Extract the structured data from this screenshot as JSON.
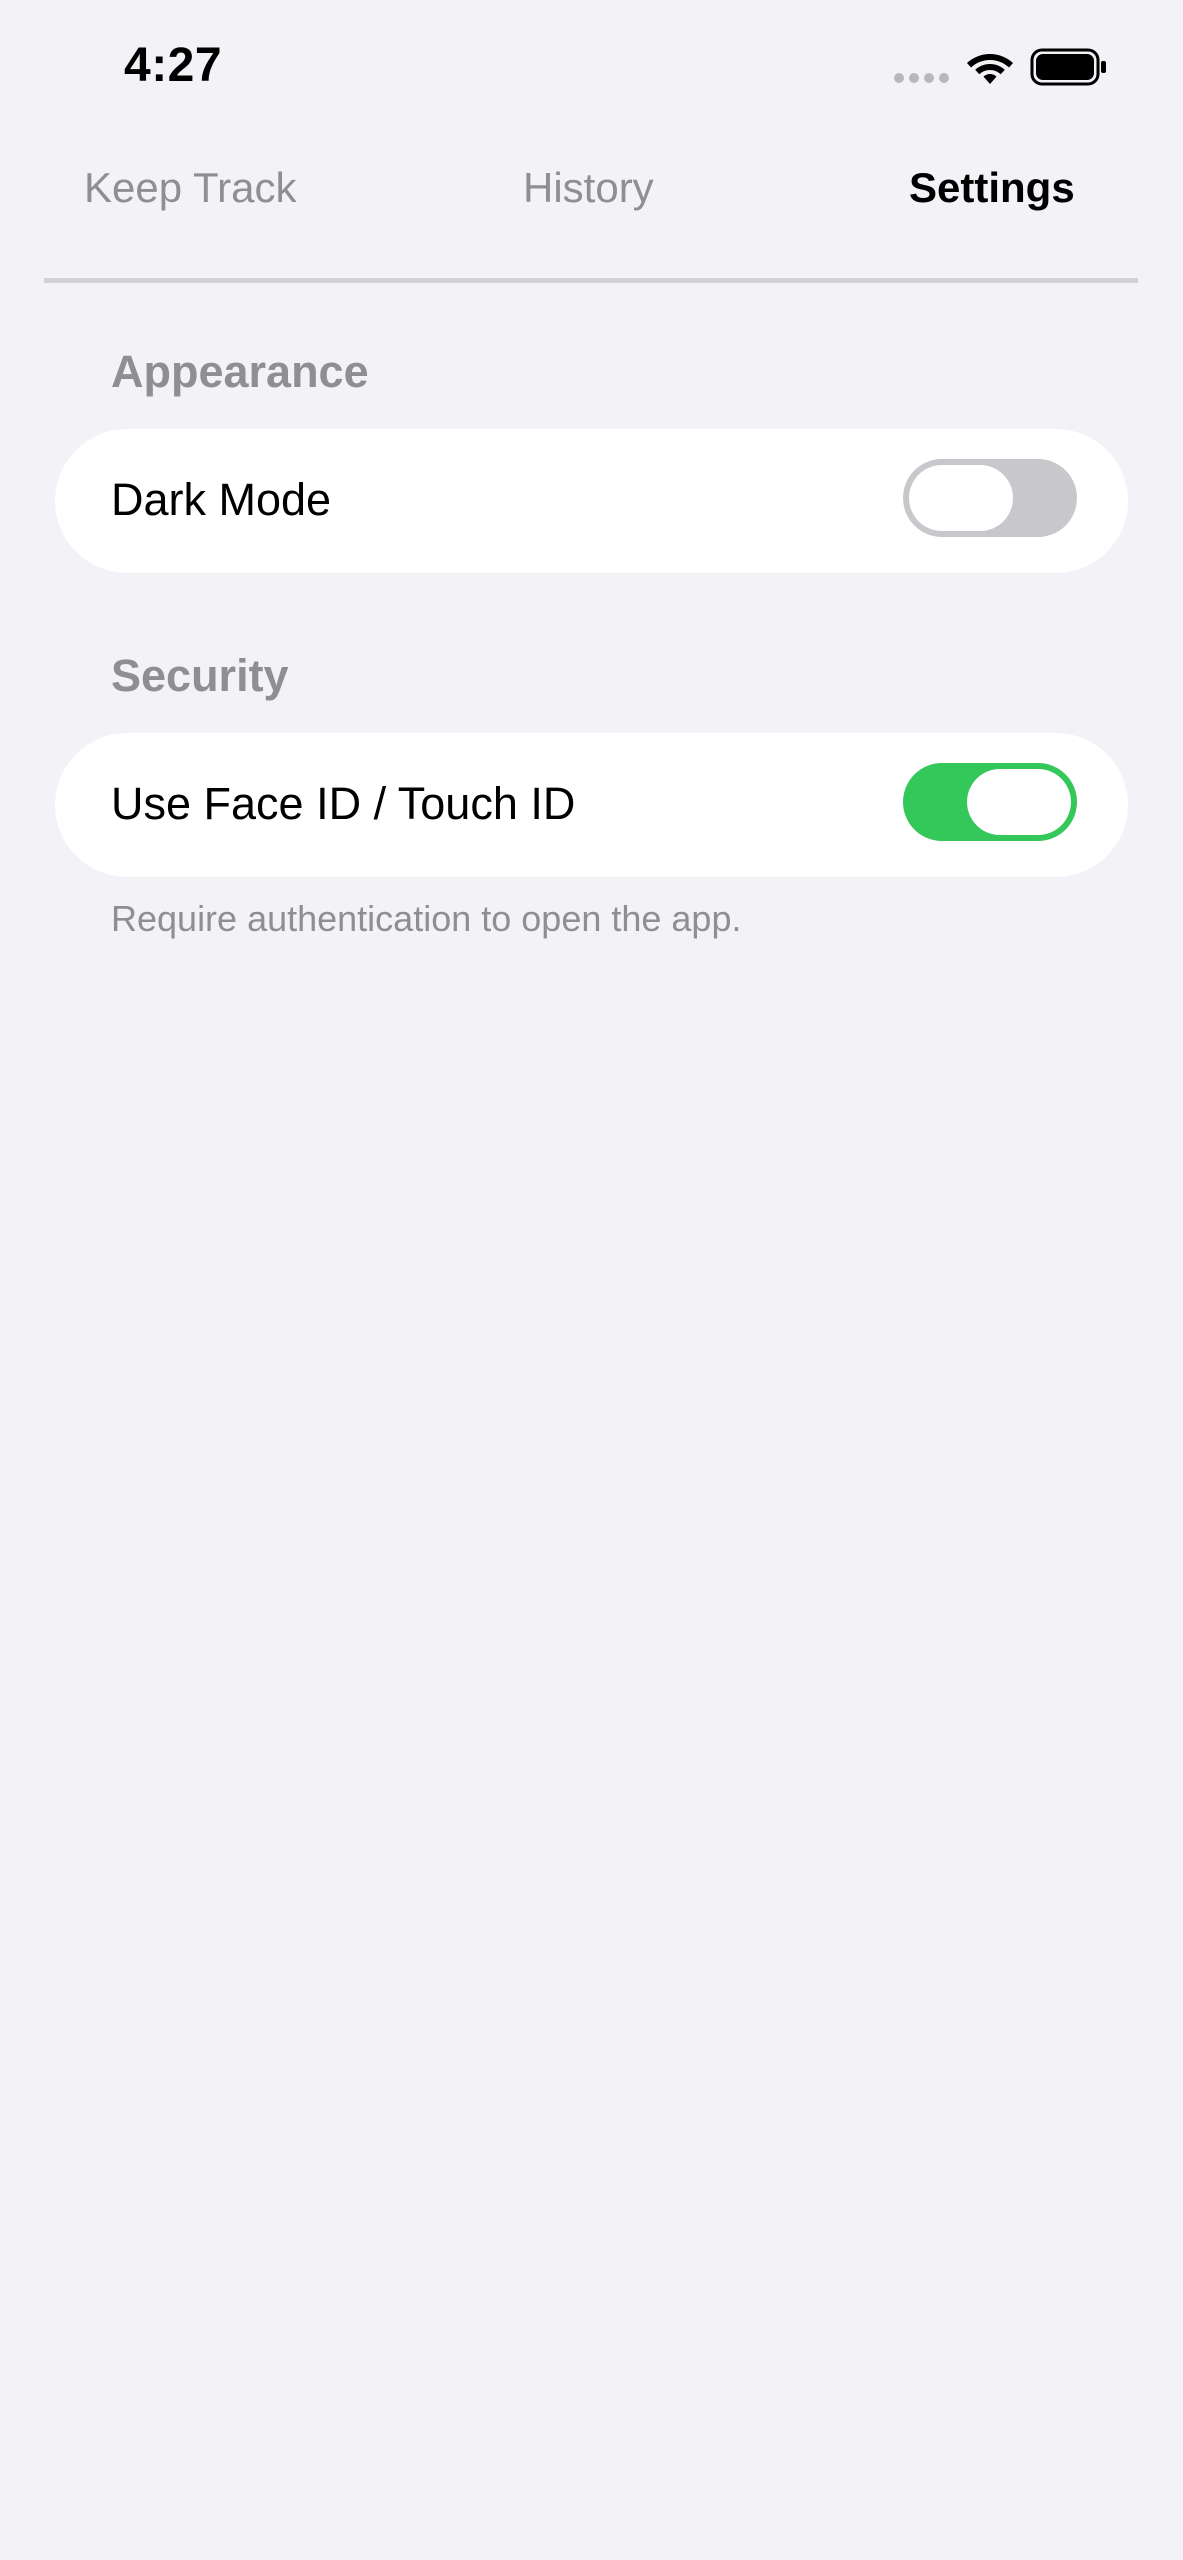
{
  "status_bar": {
    "time": "4:27",
    "signal_icon": "cellular-signal-icon",
    "wifi_icon": "wifi-icon",
    "battery_icon": "battery-icon"
  },
  "tabs": [
    {
      "label": "Keep Track",
      "active": false
    },
    {
      "label": "History",
      "active": false
    },
    {
      "label": "Settings",
      "active": true
    }
  ],
  "sections": {
    "appearance": {
      "header": "Appearance",
      "rows": [
        {
          "label": "Dark Mode",
          "toggle": false
        }
      ]
    },
    "security": {
      "header": "Security",
      "rows": [
        {
          "label": "Use Face ID / Touch ID",
          "toggle": true
        }
      ],
      "footnote": "Require authentication to open the app."
    }
  },
  "colors": {
    "background": "#f2f2f7",
    "card": "#ffffff",
    "secondary_text": "#8e8e93",
    "toggle_on": "#34c759",
    "toggle_off": "#c7c7cc"
  }
}
